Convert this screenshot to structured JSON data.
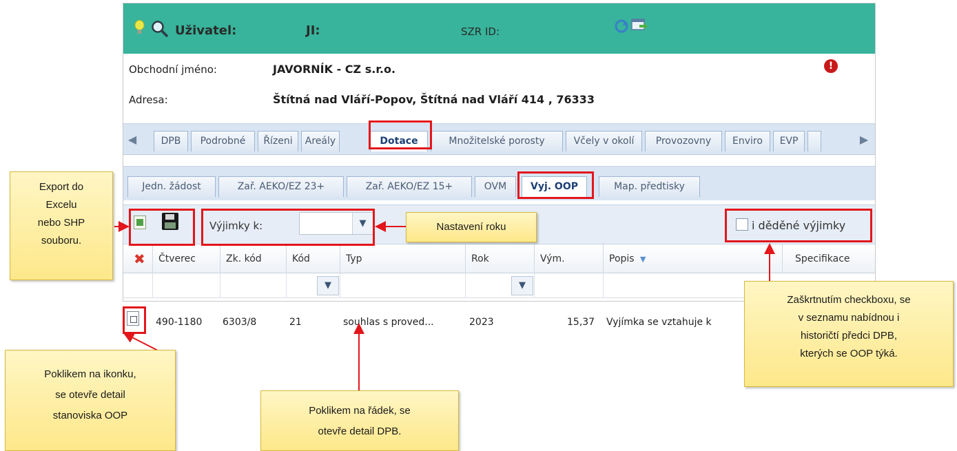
{
  "header": {
    "user_label": "Uživatel:",
    "ji_label": "JI:",
    "szr_label": "SZR ID:"
  },
  "info": {
    "company_label": "Obchodní jméno:",
    "company_value": "JAVORNÍK - CZ s.r.o.",
    "address_label": "Adresa:",
    "address_value": "Štítná nad Vláří-Popov, Štítná nad Vláří 414 , 76333",
    "error_glyph": "!"
  },
  "tabs1": [
    "DPB",
    "Podrobné",
    "Řízeni",
    "Areály",
    "Dotace",
    "Množitelské porosty",
    "Včely v okolí",
    "Provozovny",
    "Enviro",
    "EVP"
  ],
  "tabs1_active": "Dotace",
  "tabs2": [
    "Jedn. žádost",
    "Zař. AEKO/EZ 23+",
    "Zař. AEKO/EZ 15+",
    "OVM",
    "Vyj. OOP",
    "Map. předtisky"
  ],
  "tabs2_active": "Vyj. OOP",
  "toolbar": {
    "vyjimky_label": "Výjimky k:",
    "year_value": "",
    "inherited_label": "i děděné výjimky",
    "inherited_checked": false
  },
  "grid": {
    "columns": [
      "Čtverec",
      "Zk. kód",
      "Kód",
      "Typ",
      "Rok",
      "Vým.",
      "Popis",
      "Specifikace"
    ],
    "sort_glyph": "▼",
    "rows": [
      {
        "ctverec": "490-1180",
        "zk_kod": "6303/8",
        "kod": "21",
        "typ": "souhlas s proved...",
        "rok": "2023",
        "vym": "15,37",
        "popis": "Vyjímka se vztahuje k"
      }
    ]
  },
  "annotations": {
    "export": [
      "Export do",
      "Excelu",
      "nebo SHP",
      "souboru."
    ],
    "year": "Nastavení roku",
    "checkbox": [
      "Zaškrtnutím checkboxu, se",
      "v seznamu nabídnou i",
      "historičtí předci DPB,",
      "kterých se OOP týká."
    ],
    "icon": [
      "Poklikem na ikonku,",
      "se otevře detail",
      "stanoviska OOP"
    ],
    "row": [
      "Poklikem na řádek, se",
      "otevře detail DPB."
    ]
  },
  "colors": {
    "header_bg": "#37b49b",
    "highlight": "#e2161b",
    "note_bg": "#fde88a"
  }
}
